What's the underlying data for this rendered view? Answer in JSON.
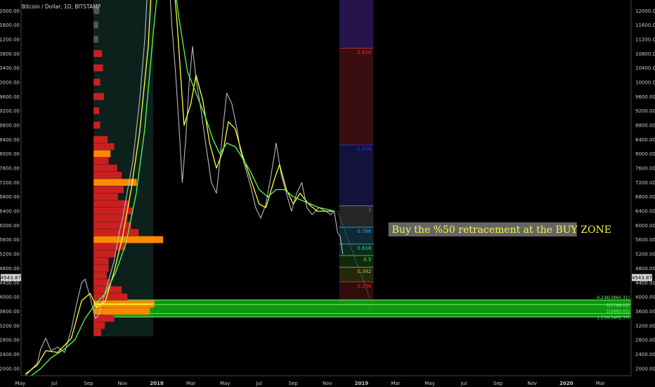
{
  "chart_data": {
    "type": "line",
    "title": "Bitcoin / Dollar, 1D, BITSTAMP",
    "ylim": [
      1800,
      12300
    ],
    "y_ticks": [
      2000,
      2400,
      2800,
      3200,
      3600,
      4000,
      4400,
      4800,
      5200,
      5600,
      6000,
      6400,
      6800,
      7200,
      7600,
      8000,
      8400,
      8800,
      9200,
      9600,
      10000,
      10400,
      10800,
      11200,
      11600,
      12000
    ],
    "x_ticks": [
      {
        "label": "May",
        "t": 0
      },
      {
        "label": "Jul",
        "t": 2
      },
      {
        "label": "Sep",
        "t": 4
      },
      {
        "label": "Nov",
        "t": 6
      },
      {
        "label": "2018",
        "t": 8
      },
      {
        "label": "Mar",
        "t": 10
      },
      {
        "label": "May",
        "t": 12
      },
      {
        "label": "Jul",
        "t": 14
      },
      {
        "label": "Sep",
        "t": 16
      },
      {
        "label": "Nov",
        "t": 18
      },
      {
        "label": "2019",
        "t": 20
      },
      {
        "label": "Mar",
        "t": 22
      },
      {
        "label": "May",
        "t": 24
      },
      {
        "label": "Jul",
        "t": 26
      },
      {
        "label": "Sep",
        "t": 28
      },
      {
        "label": "Nov",
        "t": 30
      },
      {
        "label": "2020",
        "t": 32
      },
      {
        "label": "Mar",
        "t": 34
      }
    ],
    "x_range": [
      0.05,
      35.8
    ],
    "current_price_label": "4543.87",
    "current_price": 4543.87,
    "price_path": [
      [
        0.3,
        1800
      ],
      [
        0.6,
        1950
      ],
      [
        1.0,
        2150
      ],
      [
        1.2,
        2550
      ],
      [
        1.5,
        2850
      ],
      [
        1.8,
        2500
      ],
      [
        2.2,
        2600
      ],
      [
        2.6,
        2450
      ],
      [
        3.0,
        3100
      ],
      [
        3.3,
        3800
      ],
      [
        3.6,
        4400
      ],
      [
        3.8,
        4500
      ],
      [
        4.1,
        4000
      ],
      [
        4.4,
        3400
      ],
      [
        4.6,
        3500
      ],
      [
        4.9,
        4000
      ],
      [
        5.2,
        4500
      ],
      [
        5.5,
        5000
      ],
      [
        5.8,
        5800
      ],
      [
        6.0,
        6200
      ],
      [
        6.3,
        7000
      ],
      [
        6.6,
        7800
      ],
      [
        7.0,
        9500
      ],
      [
        7.3,
        11200
      ],
      [
        7.5,
        13000
      ],
      [
        7.7,
        19000
      ],
      [
        8.4,
        17000
      ],
      [
        8.6,
        13800
      ],
      [
        8.9,
        11500
      ],
      [
        9.1,
        10300
      ],
      [
        9.3,
        8800
      ],
      [
        9.5,
        7200
      ],
      [
        9.7,
        8400
      ],
      [
        9.9,
        10000
      ],
      [
        10.1,
        11000
      ],
      [
        10.3,
        10100
      ],
      [
        10.6,
        9200
      ],
      [
        10.9,
        8200
      ],
      [
        11.2,
        7200
      ],
      [
        11.5,
        6900
      ],
      [
        11.7,
        7800
      ],
      [
        11.9,
        8800
      ],
      [
        12.1,
        9700
      ],
      [
        12.4,
        9400
      ],
      [
        12.7,
        8700
      ],
      [
        12.9,
        8100
      ],
      [
        13.2,
        7600
      ],
      [
        13.5,
        7100
      ],
      [
        13.8,
        6500
      ],
      [
        14.1,
        6200
      ],
      [
        14.4,
        6600
      ],
      [
        14.7,
        7400
      ],
      [
        15.0,
        8300
      ],
      [
        15.3,
        7400
      ],
      [
        15.6,
        6900
      ],
      [
        15.9,
        6400
      ],
      [
        16.2,
        6900
      ],
      [
        16.5,
        7200
      ],
      [
        16.8,
        6500
      ],
      [
        17.1,
        6300
      ],
      [
        17.5,
        6500
      ],
      [
        17.9,
        6400
      ],
      [
        18.2,
        6300
      ],
      [
        18.4,
        6400
      ],
      [
        18.6,
        5800
      ],
      [
        18.75,
        5700
      ],
      [
        18.9,
        5200
      ]
    ],
    "ma_series": [
      {
        "color": "#ffff33",
        "values": [
          [
            0.3,
            1850
          ],
          [
            1.0,
            2100
          ],
          [
            1.5,
            2500
          ],
          [
            2.2,
            2450
          ],
          [
            3.0,
            2850
          ],
          [
            3.6,
            3900
          ],
          [
            4.1,
            4100
          ],
          [
            4.5,
            3700
          ],
          [
            5.0,
            3900
          ],
          [
            5.5,
            4700
          ],
          [
            6.0,
            5700
          ],
          [
            6.5,
            7000
          ],
          [
            7.0,
            8600
          ],
          [
            7.5,
            11000
          ],
          [
            7.9,
            14500
          ],
          [
            8.4,
            16000
          ],
          [
            8.8,
            14000
          ],
          [
            9.2,
            11600
          ],
          [
            9.6,
            8800
          ],
          [
            10.0,
            9400
          ],
          [
            10.3,
            10200
          ],
          [
            10.7,
            9500
          ],
          [
            11.1,
            8300
          ],
          [
            11.5,
            7600
          ],
          [
            11.9,
            8100
          ],
          [
            12.2,
            8900
          ],
          [
            12.6,
            8700
          ],
          [
            13.0,
            8000
          ],
          [
            13.5,
            7300
          ],
          [
            14.0,
            6600
          ],
          [
            14.4,
            6500
          ],
          [
            14.9,
            7300
          ],
          [
            15.2,
            7700
          ],
          [
            15.6,
            7000
          ],
          [
            16.0,
            6600
          ],
          [
            16.4,
            6900
          ],
          [
            16.9,
            6600
          ],
          [
            17.4,
            6400
          ],
          [
            17.9,
            6400
          ],
          [
            18.4,
            6400
          ]
        ]
      },
      {
        "color": "#55ff55",
        "values": [
          [
            0.5,
            1750
          ],
          [
            1.2,
            2000
          ],
          [
            1.8,
            2300
          ],
          [
            2.6,
            2550
          ],
          [
            3.2,
            2800
          ],
          [
            3.8,
            3400
          ],
          [
            4.4,
            3800
          ],
          [
            5.0,
            4100
          ],
          [
            5.6,
            4700
          ],
          [
            6.2,
            5500
          ],
          [
            6.8,
            6900
          ],
          [
            7.3,
            8700
          ],
          [
            7.8,
            11400
          ],
          [
            8.3,
            13800
          ],
          [
            8.8,
            13600
          ],
          [
            9.3,
            11800
          ],
          [
            9.8,
            10300
          ],
          [
            10.3,
            9700
          ],
          [
            10.8,
            9100
          ],
          [
            11.3,
            8400
          ],
          [
            11.7,
            8000
          ],
          [
            12.1,
            8300
          ],
          [
            12.6,
            8200
          ],
          [
            13.0,
            7900
          ],
          [
            13.5,
            7500
          ],
          [
            14.0,
            7000
          ],
          [
            14.5,
            6800
          ],
          [
            15.0,
            7000
          ],
          [
            15.5,
            7000
          ],
          [
            16.0,
            6800
          ],
          [
            16.5,
            6700
          ],
          [
            17.0,
            6600
          ],
          [
            17.5,
            6500
          ],
          [
            18.0,
            6450
          ],
          [
            18.4,
            6400
          ]
        ]
      }
    ],
    "volume_profile": {
      "x_start": 4.3,
      "bars": [
        [
          12000,
          0.6,
          "#555555"
        ],
        [
          11600,
          0.5,
          "#555555"
        ],
        [
          11200,
          0.5,
          "#555555"
        ],
        [
          10800,
          0.9,
          "#cc1f1f"
        ],
        [
          10400,
          1.0,
          "#cc1f1f"
        ],
        [
          10000,
          0.7,
          "#cc1f1f"
        ],
        [
          9600,
          1.1,
          "#cc1f1f"
        ],
        [
          9200,
          0.6,
          "#cc1f1f"
        ],
        [
          8800,
          0.7,
          "#cc1f1f"
        ],
        [
          8400,
          1.5,
          "#cc1f1f"
        ],
        [
          8200,
          2.2,
          "#cc1f1f"
        ],
        [
          8000,
          1.8,
          "#ff8800"
        ],
        [
          7800,
          1.6,
          "#cc1f1f"
        ],
        [
          7600,
          2.5,
          "#cc1f1f"
        ],
        [
          7400,
          3.0,
          "#cc1f1f"
        ],
        [
          7200,
          4.6,
          "#ff8800"
        ],
        [
          7000,
          3.2,
          "#cc1f1f"
        ],
        [
          6800,
          2.6,
          "#cc1f1f"
        ],
        [
          6600,
          3.8,
          "#cc1f1f"
        ],
        [
          6400,
          4.2,
          "#cc1f1f"
        ],
        [
          6200,
          3.6,
          "#cc1f1f"
        ],
        [
          6000,
          4.0,
          "#cc1f1f"
        ],
        [
          5800,
          4.8,
          "#cc1f1f"
        ],
        [
          5600,
          7.4,
          "#ff8800"
        ],
        [
          5400,
          3.4,
          "#cc1f1f"
        ],
        [
          5200,
          2.3,
          "#cc1f1f"
        ],
        [
          5000,
          1.6,
          "#cc1f1f"
        ],
        [
          4800,
          1.6,
          "#cc1f1f"
        ],
        [
          4600,
          1.4,
          "#cc1f1f"
        ],
        [
          4400,
          1.8,
          "#cc1f1f"
        ],
        [
          4200,
          3.0,
          "#cc1f1f"
        ],
        [
          4000,
          3.6,
          "#cc1f1f"
        ],
        [
          3800,
          6.5,
          "#ff8800"
        ],
        [
          3600,
          6.0,
          "#ff8800"
        ],
        [
          3400,
          2.2,
          "#cc1f1f"
        ],
        [
          3200,
          1.2,
          "#cc1f1f"
        ],
        [
          3000,
          0.8,
          "#cc1f1f"
        ]
      ],
      "poc_price": 3800
    },
    "range_highlight": {
      "x0": 4.3,
      "x1": 7.8,
      "color": "#0c201c"
    },
    "fib": {
      "x0": 18.7,
      "x1": 20.7,
      "levels": [
        {
          "ratio": "2.618",
          "price": 10950,
          "color": "#e03030"
        },
        {
          "ratio": "1.618",
          "price": 8250,
          "color": "#3a3ad8"
        },
        {
          "ratio": "1",
          "price": 6550,
          "color": "#808080"
        },
        {
          "ratio": "0.786",
          "price": 5950,
          "color": "#3aa0e0"
        },
        {
          "ratio": "0.618",
          "price": 5480,
          "color": "#30d0a0"
        },
        {
          "ratio": "0.5",
          "price": 5160,
          "color": "#55e055"
        },
        {
          "ratio": "0.382",
          "price": 4830,
          "color": "#a0d030"
        },
        {
          "ratio": "0.236",
          "price": 4420,
          "color": "#e03030"
        },
        {
          "ratio": "0",
          "price": 3780,
          "color": "#808080"
        }
      ],
      "zones": [
        {
          "from": 12300,
          "to": 10950,
          "color": "#25154a"
        },
        {
          "from": 10950,
          "to": 8250,
          "color": "#3a0e10"
        },
        {
          "from": 8250,
          "to": 6550,
          "color": "#12123a"
        },
        {
          "from": 6550,
          "to": 5950,
          "color": "#252525"
        },
        {
          "from": 5950,
          "to": 5480,
          "color": "#0e2a38"
        },
        {
          "from": 5480,
          "to": 5160,
          "color": "#0c2a22"
        },
        {
          "from": 5160,
          "to": 4830,
          "color": "#102a10"
        },
        {
          "from": 4830,
          "to": 4420,
          "color": "#25280c"
        },
        {
          "from": 4420,
          "to": 3780,
          "color": "#300c0c"
        }
      ]
    },
    "buy_zone": {
      "x0": 5.0,
      "x1": 35.8,
      "top": 3920,
      "bottom": 3430,
      "color": "#10b010",
      "lines": [
        {
          "price": 3920,
          "label": "-0.236(3960.31)",
          "color": "#7dff7d"
        },
        {
          "price": 3790,
          "label": "0(3788.05)",
          "color": "#7dff7d"
        },
        {
          "price": 3540,
          "label": "1(3492.03)",
          "color": "#7dff7d"
        },
        {
          "price": 3440,
          "label": "1.236(3402.37)",
          "color": "#7dff7d"
        }
      ]
    },
    "projection": {
      "from": [
        18.6,
        6400
      ],
      "to": [
        20.5,
        3950
      ],
      "color": "#888888"
    },
    "annotation": {
      "text": "Buy the %50 retracement at the BUY ZONE",
      "price": 5850,
      "t": 21.7
    }
  }
}
